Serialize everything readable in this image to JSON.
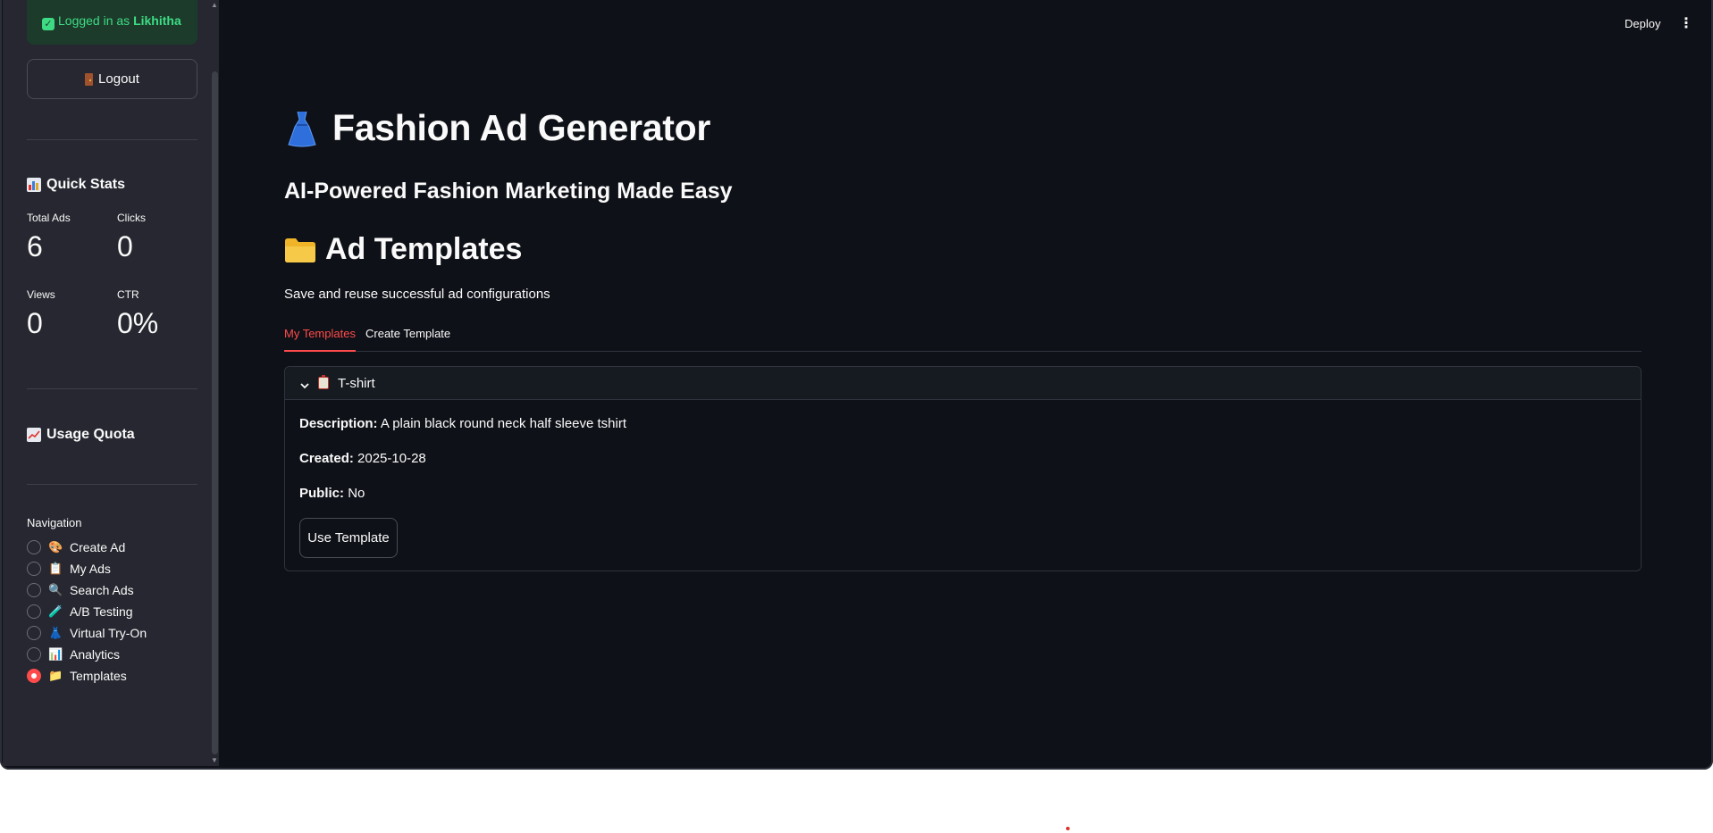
{
  "sidebar": {
    "login_prefix": "Logged in as ",
    "login_user": "Likhitha",
    "logout_label": "Logout",
    "quick_stats_title": "Quick Stats",
    "stats": {
      "total_ads_label": "Total Ads",
      "total_ads_value": "6",
      "clicks_label": "Clicks",
      "clicks_value": "0",
      "views_label": "Views",
      "views_value": "0",
      "ctr_label": "CTR",
      "ctr_value": "0%"
    },
    "usage_quota_title": "Usage Quota",
    "navigation_title": "Navigation",
    "nav_items": [
      {
        "label": "Create Ad",
        "icon": "palette-icon",
        "selected": false
      },
      {
        "label": "My Ads",
        "icon": "clipboard-icon",
        "selected": false
      },
      {
        "label": "Search Ads",
        "icon": "magnifier-icon",
        "selected": false
      },
      {
        "label": "A/B Testing",
        "icon": "test-tube-icon",
        "selected": false
      },
      {
        "label": "Virtual Try-On",
        "icon": "person-icon",
        "selected": false
      },
      {
        "label": "Analytics",
        "icon": "bar-chart-icon",
        "selected": false
      },
      {
        "label": "Templates",
        "icon": "folder-icon",
        "selected": true
      }
    ]
  },
  "header": {
    "deploy_label": "Deploy"
  },
  "main": {
    "title": "Fashion Ad Generator",
    "subtitle": "AI-Powered Fashion Marketing Made Easy",
    "section_title": "Ad Templates",
    "section_description": "Save and reuse successful ad configurations",
    "tabs": [
      {
        "label": "My Templates",
        "active": true
      },
      {
        "label": "Create Template",
        "active": false
      }
    ],
    "template": {
      "name": "T-shirt",
      "description_label": "Description:",
      "description_value": "A plain black round neck half sleeve tshirt",
      "created_label": "Created:",
      "created_value": "2025-10-28",
      "public_label": "Public:",
      "public_value": "No",
      "use_button_label": "Use Template"
    }
  },
  "colors": {
    "background": "#0e1117",
    "sidebar": "#262730",
    "accent": "#ff4b4b",
    "success": "#3ddc84"
  }
}
